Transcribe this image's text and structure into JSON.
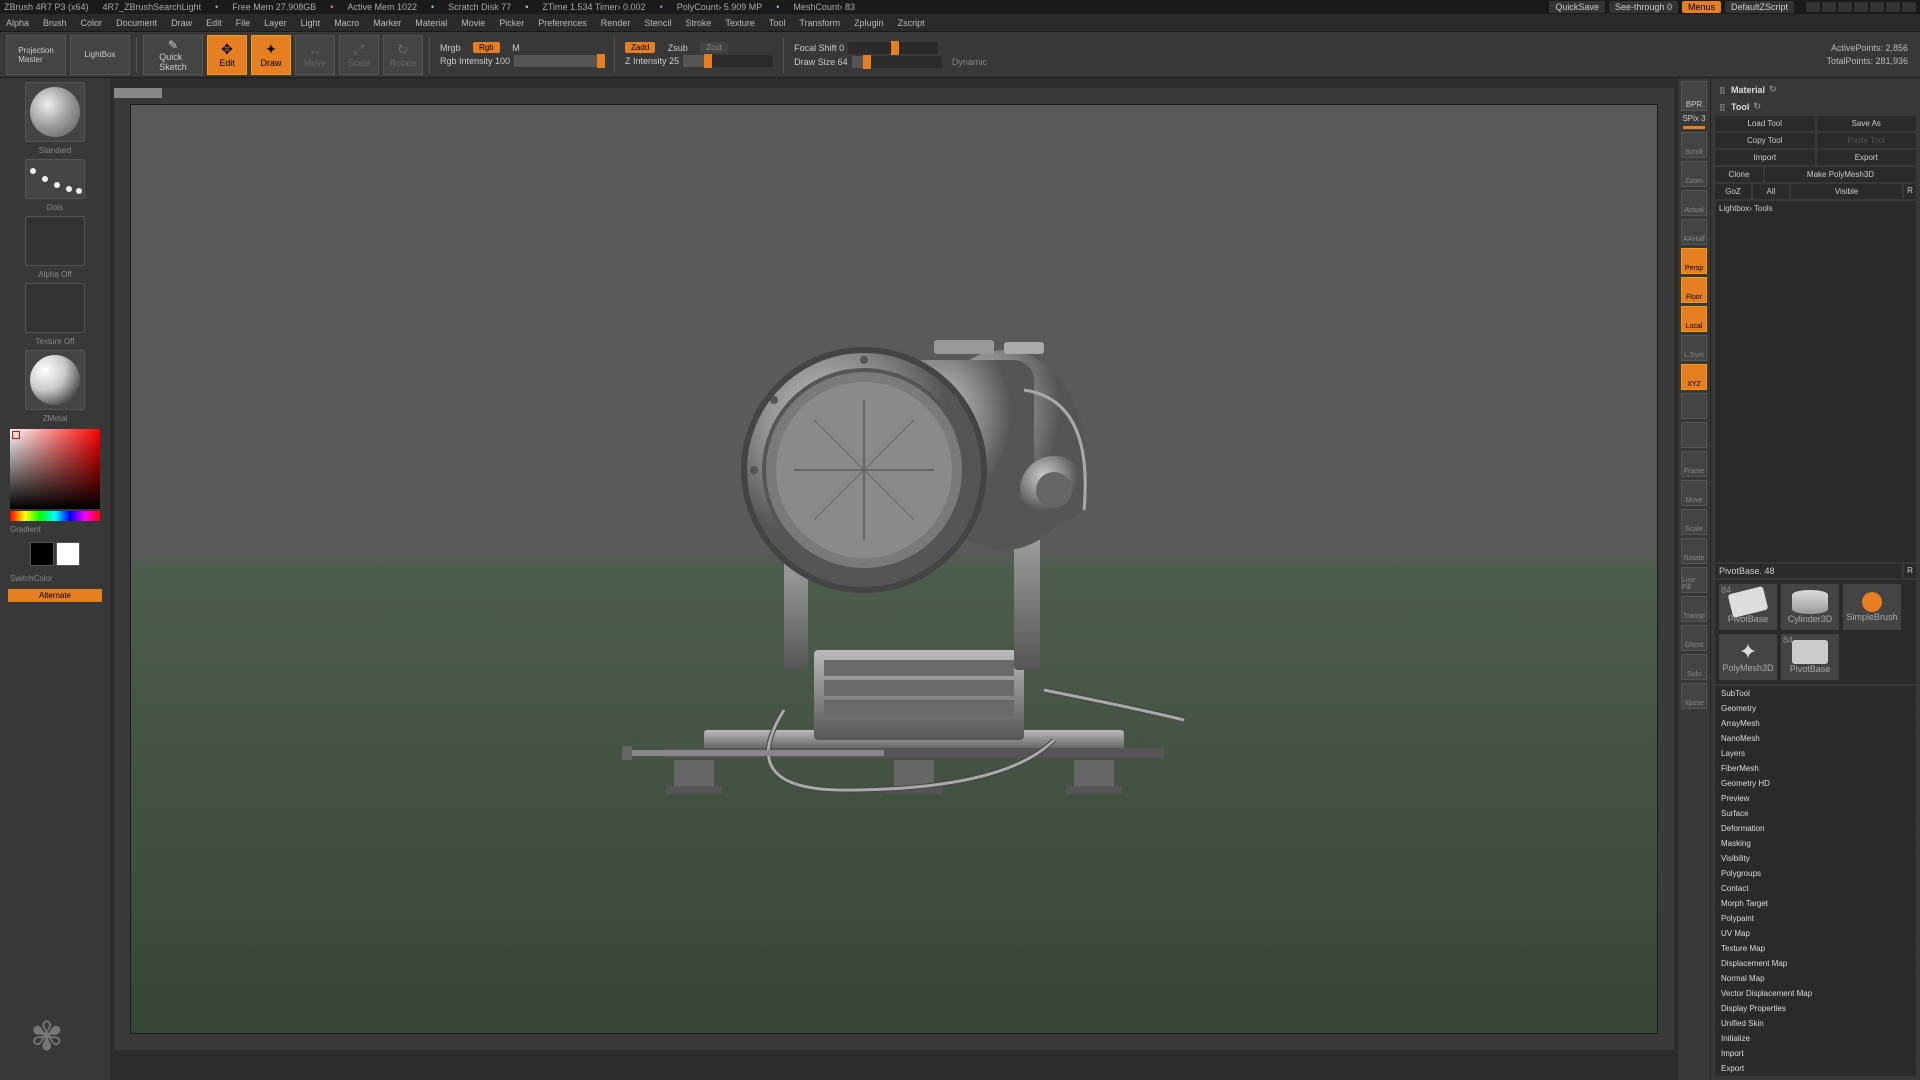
{
  "titlebar": {
    "app": "ZBrush 4R7 P3 (x64)",
    "doc": "4R7_ZBrushSearchLight",
    "mem": "Free Mem 27.908GB",
    "active": "Active Mem 1022",
    "scratch": "Scratch Disk 77",
    "ztime": "ZTime 1.534 Timer› 0.002",
    "poly": "PolyCount› 5.909 MP",
    "mesh": "MeshCount› 83",
    "quicksave": "QuickSave",
    "seethru": "See-through  0",
    "menus": "Menus",
    "script": "DefaultZScript"
  },
  "menubar": [
    "Alpha",
    "Brush",
    "Color",
    "Document",
    "Draw",
    "Edit",
    "File",
    "Layer",
    "Light",
    "Macro",
    "Marker",
    "Material",
    "Movie",
    "Picker",
    "Preferences",
    "Render",
    "Stencil",
    "Stroke",
    "Texture",
    "Tool",
    "Transform",
    "Zplugin",
    "Zscript"
  ],
  "toolbar": {
    "projection": "Projection\nMaster",
    "lightbox": "LightBox",
    "quicksketch": "Quick\nSketch",
    "edit": "Edit",
    "draw": "Draw",
    "move": "Move",
    "scale": "Scale",
    "rotate": "Rotate",
    "mrgb": "Mrgb",
    "rgb": "Rgb",
    "m": "M",
    "rgbInt": "Rgb Intensity 100",
    "zadd": "Zadd",
    "zsub": "Zsub",
    "zcut": "Zcut",
    "zint": "Z Intensity 25",
    "focal": "Focal Shift 0",
    "drawsize": "Draw Size 64",
    "dynamic": "Dynamic",
    "activepts": "ActivePoints: 2,856",
    "totalpts": "TotalPoints: 281,936"
  },
  "left": {
    "brush_lbl": "Standard",
    "stroke_lbl": "Dots",
    "alpha_lbl": "Alpha Off",
    "texture_lbl": "Texture Off",
    "material_lbl": "ZMetal",
    "gradient": "Gradient",
    "switchcolor": "SwitchColor",
    "alternate": "Alternate"
  },
  "rightIcons": [
    "BPR",
    "Scroll",
    "Zoom",
    "Actual",
    "AAHalf",
    "Persp",
    "Floor",
    "Local",
    "L.Sym",
    "XYZ",
    "",
    "",
    "Frame",
    "Move",
    "Scale",
    "Rotate",
    "Line Fill",
    "Transp",
    "Ghost",
    "Solo",
    "Xpose"
  ],
  "rightIconsActive": [
    false,
    false,
    false,
    false,
    false,
    true,
    true,
    true,
    false,
    true,
    false,
    false,
    false,
    false,
    false,
    false,
    false,
    false,
    false,
    false,
    false
  ],
  "rpanel": {
    "title1": "Material",
    "title2": "Tool",
    "load": "Load Tool",
    "saveas": "Save As",
    "copy": "Copy Tool",
    "paste": "Paste Tool",
    "import": "Import",
    "export": "Export",
    "clone": "Clone",
    "makepoly": "Make PolyMesh3D",
    "goz": "GoZ",
    "all": "All",
    "visible": "Visible",
    "r": "R",
    "lightboxtools": "Lightbox› Tools",
    "pivot": "PivotBase. 48",
    "thumbs": [
      "PivotBase",
      "Cylinder3D",
      "SimpleBrush",
      "PolyMesh3D",
      "PivotBase"
    ],
    "eighty4": "84",
    "sections": [
      "SubTool",
      "Geometry",
      "ArrayMesh",
      "NanoMesh",
      "Layers",
      "FiberMesh",
      "Geometry HD",
      "Preview",
      "Surface",
      "Deformation",
      "Masking",
      "Visibility",
      "Polygroups",
      "Contact",
      "Morph Target",
      "Polypaint",
      "UV Map",
      "Texture Map",
      "Displacement Map",
      "Normal Map",
      "Vector Displacement Map",
      "Display Properties",
      "Unified Skin",
      "Initialize",
      "Import",
      "Export"
    ]
  },
  "spix": "SPix 3"
}
